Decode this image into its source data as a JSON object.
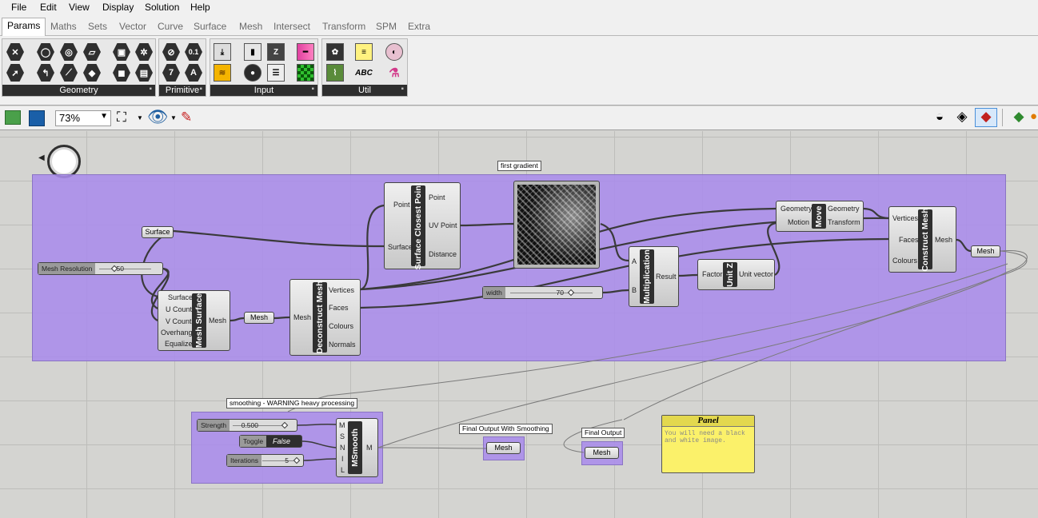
{
  "menu": [
    "File",
    "Edit",
    "View",
    "Display",
    "Solution",
    "Help"
  ],
  "tabs": [
    "Params",
    "Maths",
    "Sets",
    "Vector",
    "Curve",
    "Surface",
    "Mesh",
    "Intersect",
    "Transform",
    "SPM",
    "Extra"
  ],
  "ribbon": {
    "geometry": "Geometry",
    "primitive": "Primitive",
    "input": "Input",
    "util": "Util",
    "primitive_glyphs": [
      "0.1",
      "7",
      "A"
    ],
    "util_glyph": "ABC"
  },
  "toolbar": {
    "zoom": "73%"
  },
  "nodes": {
    "surface_param": "Surface",
    "mesh_res_label": "Mesh Resolution",
    "mesh_res_value": "50",
    "mesh_surface": {
      "title": "Mesh Surface",
      "inputs": [
        "Surface",
        "U Count",
        "V Count",
        "Overhang",
        "Equalize"
      ],
      "output": "Mesh"
    },
    "mesh_param1": "Mesh",
    "deconstruct": {
      "title": "Deconstruct Mesh",
      "input": "Mesh",
      "outputs": [
        "Vertices",
        "Faces",
        "Colours",
        "Normals"
      ]
    },
    "scp": {
      "title": "Surface Closest Point",
      "inputs": [
        "Point",
        "Surface"
      ],
      "outputs": [
        "Point",
        "UV Point",
        "Distance"
      ]
    },
    "image_label": "first gradient",
    "width_label": "width",
    "width_value": "70",
    "multiplication": {
      "title": "Multiplication",
      "inputs": [
        "A",
        "B"
      ],
      "output": "Result"
    },
    "unitz": {
      "title": "Unit Z",
      "input": "Factor",
      "output": "Unit vector"
    },
    "move": {
      "title": "Move",
      "inputs": [
        "Geometry",
        "Motion"
      ],
      "outputs": [
        "Geometry",
        "Transform"
      ]
    },
    "construct": {
      "title": "Construct Mesh",
      "inputs": [
        "Vertices",
        "Faces",
        "Colours"
      ],
      "output": "Mesh"
    },
    "mesh_param2": "Mesh",
    "smoothing_label": "smoothing - WARNING heavy processing",
    "strength_label": "Strength",
    "strength_value": "0.500",
    "toggle_label": "Toggle",
    "toggle_value": "False",
    "iterations_label": "Iterations",
    "iterations_value": "5",
    "msmooth": {
      "title": "MSmooth",
      "inputs": [
        "M",
        "S",
        "N",
        "I",
        "L"
      ],
      "output": "M"
    },
    "final_smooth_label": "Final Output With Smoothing",
    "final_smooth_param": "Mesh",
    "final_label": "Final Output",
    "final_param": "Mesh",
    "panel_title": "Panel",
    "panel_text": "You will need a black\nand white image."
  }
}
